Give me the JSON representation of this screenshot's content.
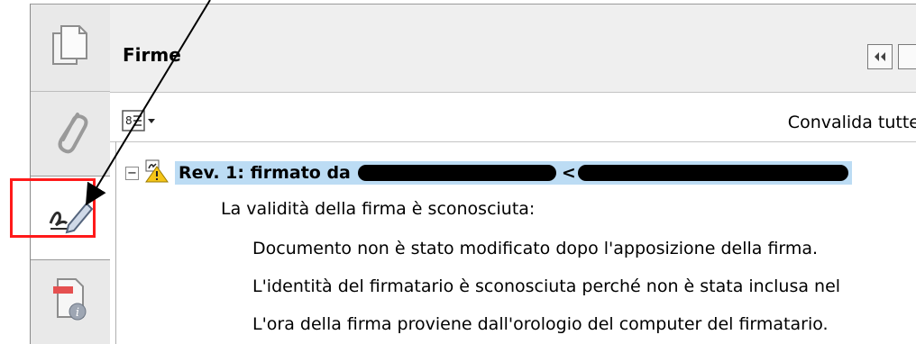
{
  "sidebar": {
    "items": [
      {
        "name": "pages",
        "icon": "pages-icon"
      },
      {
        "name": "attachments",
        "icon": "paperclip-icon"
      },
      {
        "name": "signatures",
        "icon": "signature-pen-icon",
        "selected": true
      },
      {
        "name": "document-properties",
        "icon": "document-info-icon"
      }
    ]
  },
  "panel": {
    "title": "Firme",
    "validate_all_label": "Convalida tutte"
  },
  "signature": {
    "header_label": "Rev. 1: firmato da",
    "header_separator": "<",
    "status_line": "La validità della firma è sconosciuta:",
    "details": [
      "Documento non è stato modificato dopo l'apposizione della firma.",
      "L'identità del firmatario è sconosciuta perché non è stata inclusa nel",
      "L'ora della firma proviene dall'orologio del computer del firmatario."
    ]
  },
  "colors": {
    "highlight_box": "#ff1a1a",
    "selected_row": "#bcdcf4",
    "warning_icon": "#f5c518"
  }
}
